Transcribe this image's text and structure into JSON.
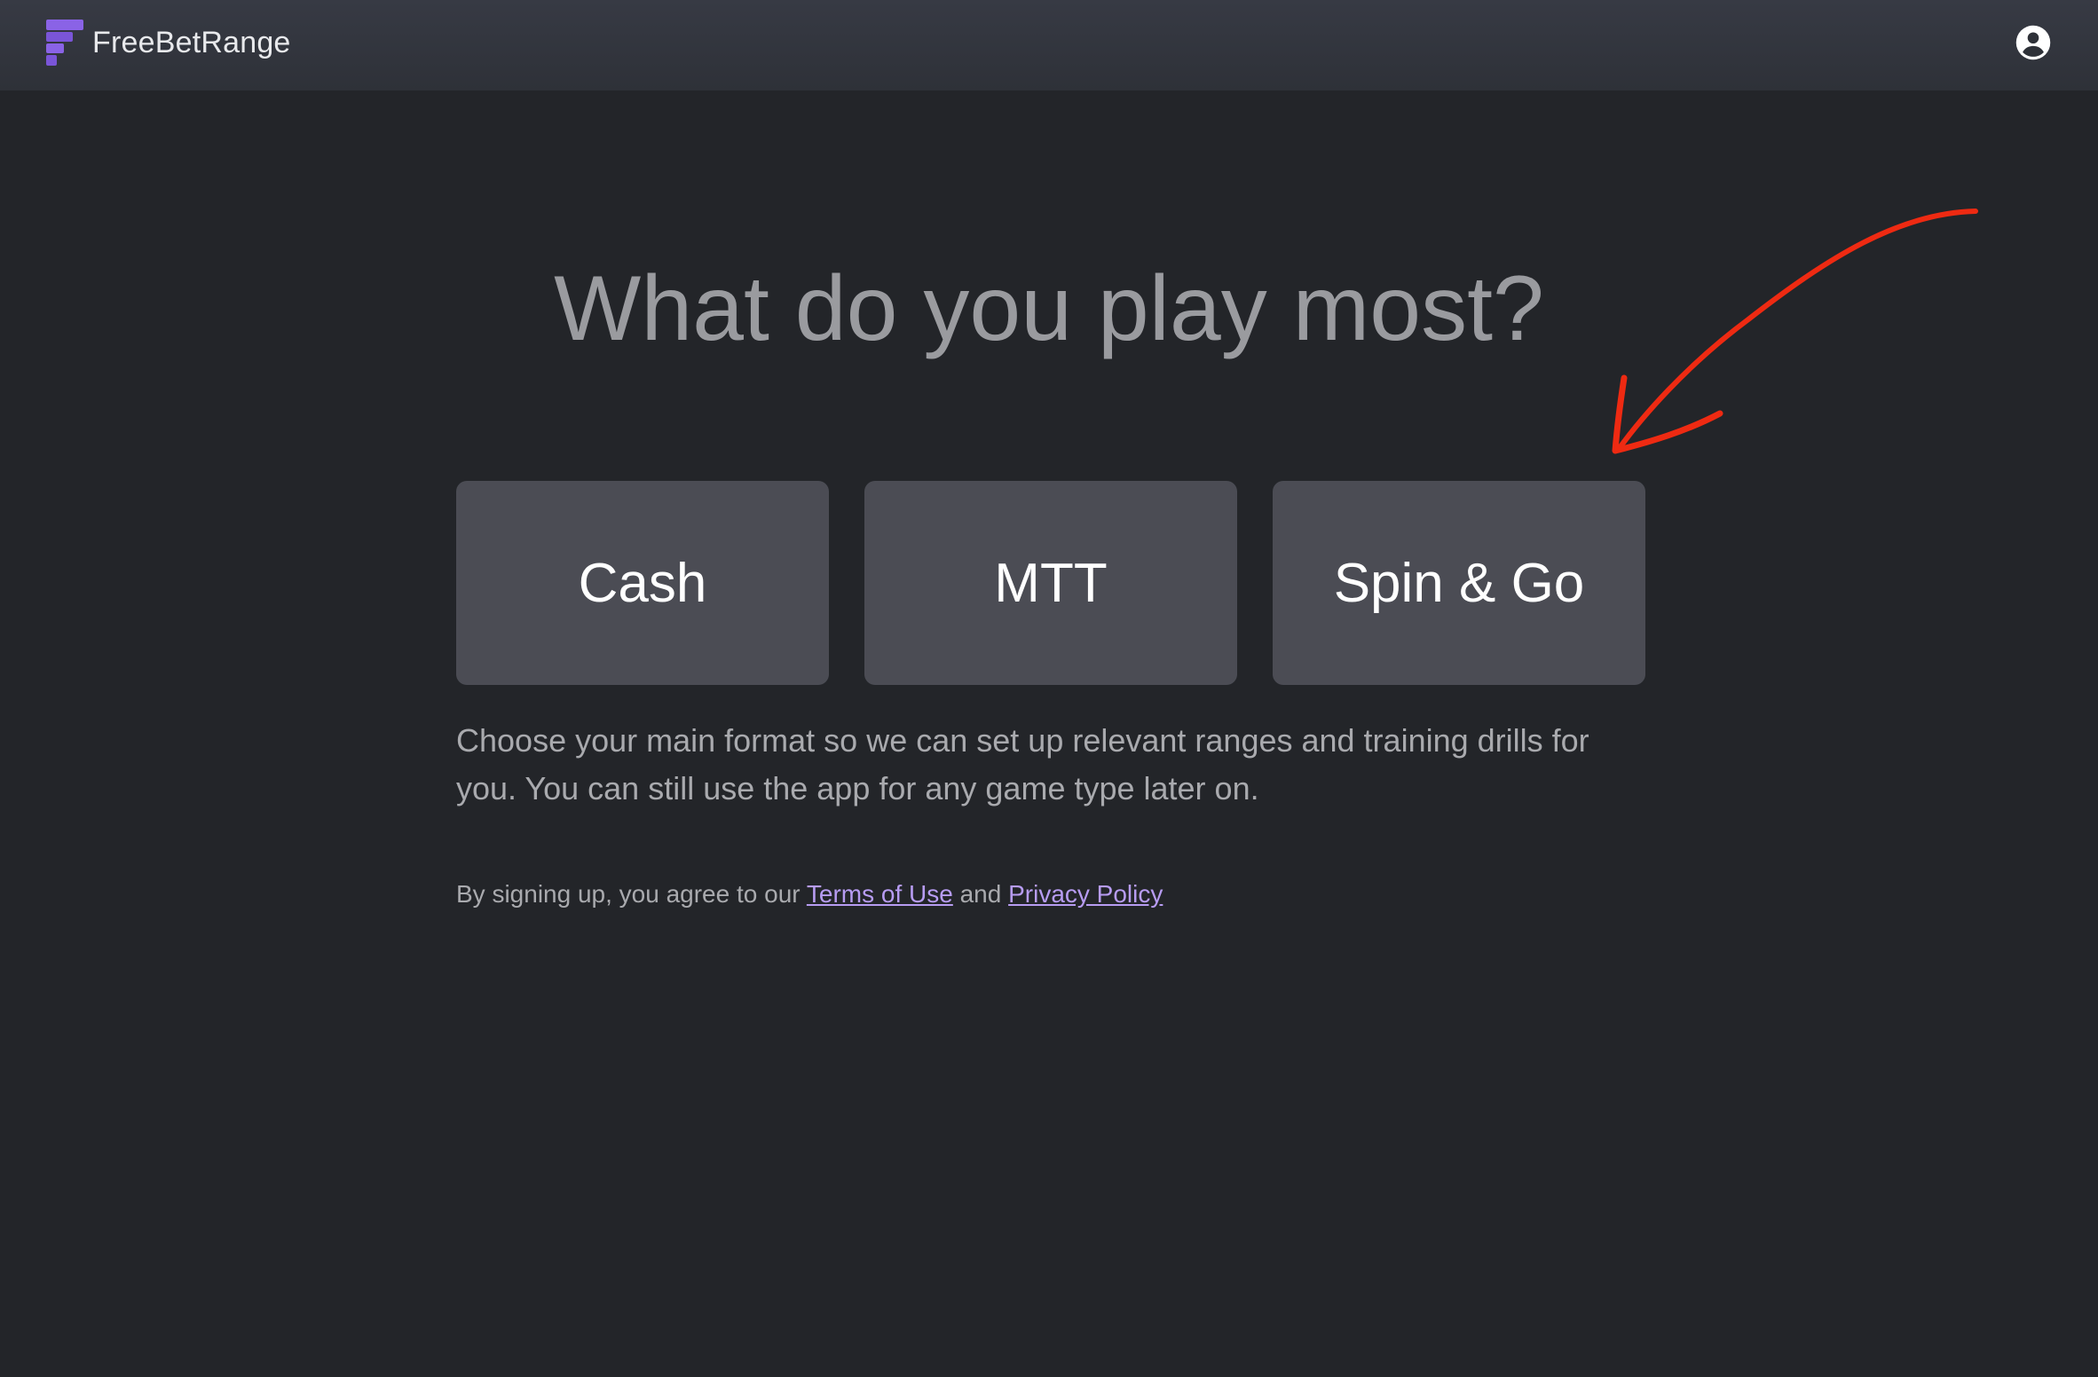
{
  "header": {
    "brand_name": "FreeBetRange",
    "logo_icon": "freebetrange-logo-icon",
    "account_icon": "account-circle-icon"
  },
  "main": {
    "heading": "What do you play most?",
    "options": [
      {
        "label": "Cash"
      },
      {
        "label": "MTT"
      },
      {
        "label": "Spin & Go"
      }
    ],
    "description": "Choose your main format so we can set up relevant ranges and training drills for you. You can still use the app for any game type later on.",
    "terms": {
      "prefix": "By signing up, you agree to our",
      "terms_link": "Terms of Use",
      "conjunction": "and",
      "privacy_link": "Privacy Policy"
    }
  },
  "annotation": {
    "arrow_icon": "hand-drawn-arrow-icon",
    "color": "#ee2a12"
  },
  "colors": {
    "brand_purple": "#8a63e6",
    "link_purple": "#b79cf2",
    "background": "#232529",
    "card": "#4b4c54"
  }
}
